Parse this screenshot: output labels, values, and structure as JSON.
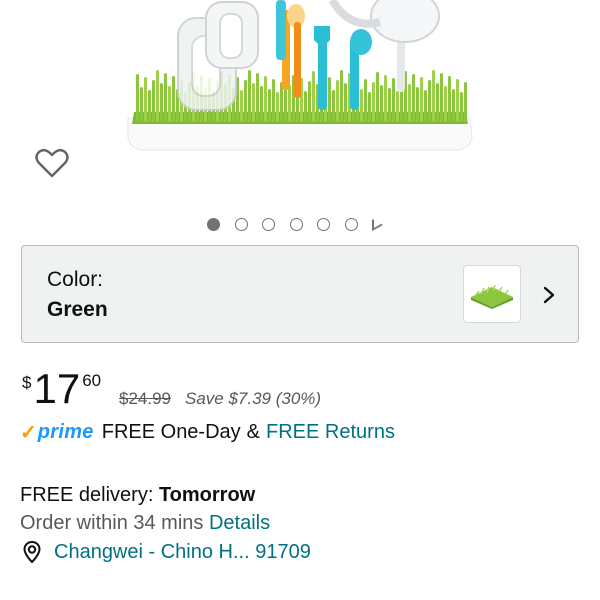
{
  "product": {
    "image_alt": "Grass drying rack with bottles and utensils"
  },
  "carousel": {
    "dot_count": 6,
    "active_index": 0
  },
  "color": {
    "label": "Color:",
    "value": "Green",
    "swatch_color": "#8cc63f"
  },
  "price": {
    "currency": "$",
    "whole": "17",
    "fraction": "60",
    "list_price": "$24.99",
    "savings": "Save $7.39 (30%)"
  },
  "prime": {
    "logo_text": "prime",
    "shipping": "FREE One-Day",
    "ampersand": "&",
    "returns_link": "FREE Returns"
  },
  "delivery": {
    "prefix": "FREE delivery: ",
    "day": "Tomorrow",
    "order_within": "Order within 34 mins ",
    "details_link": "Details",
    "location": "Changwei - Chino H... 91709"
  },
  "colors": {
    "link": "#007185",
    "prime_blue": "#1a98ff",
    "prime_orange": "#ff9900",
    "grass_green": "#8cc63f"
  },
  "icons": {
    "favorite": "heart-outline-icon",
    "chevron": "chevron-right-icon",
    "location": "location-pin-icon"
  }
}
